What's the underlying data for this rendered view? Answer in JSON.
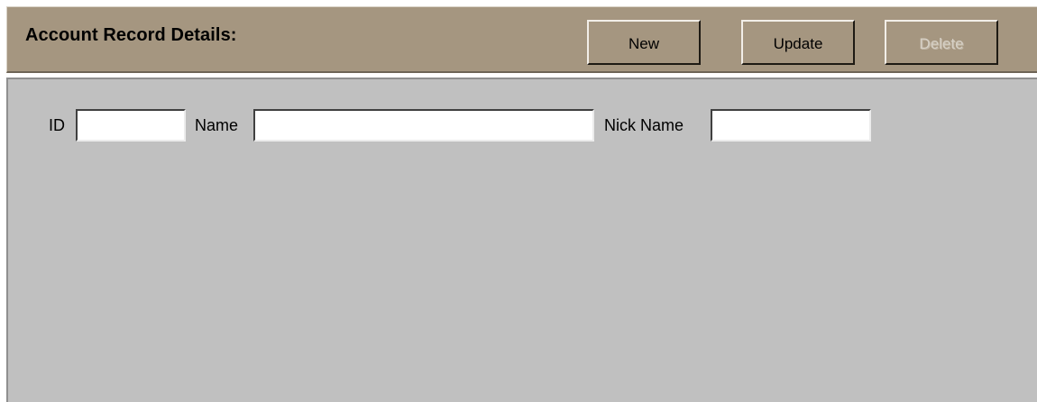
{
  "header": {
    "title": "Account Record Details:",
    "buttons": {
      "new_label": "New",
      "update_label": "Update",
      "delete_label": "Delete",
      "delete_enabled": false
    }
  },
  "form": {
    "id": {
      "label": "ID",
      "value": ""
    },
    "name": {
      "label": "Name",
      "value": ""
    },
    "nick_name": {
      "label": "Nick Name",
      "value": ""
    }
  },
  "colors": {
    "header_bg": "#a59680",
    "panel_bg": "#c0c0c0",
    "disabled_text": "#d6d0c5"
  }
}
